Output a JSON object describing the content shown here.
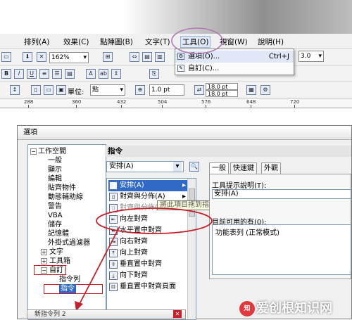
{
  "menubar": {
    "items": [
      {
        "label": "排列(A)"
      },
      {
        "label": "效果(C)"
      },
      {
        "label": "點陣圖(B)"
      },
      {
        "label": "文字(T)"
      },
      {
        "label": "工具(O)"
      },
      {
        "label": "視窗(W)"
      },
      {
        "label": "說明(H)"
      }
    ]
  },
  "toolbar1": {
    "zoom_value": "162%"
  },
  "tools_menu": {
    "items": [
      {
        "label": "選項(O)...",
        "shortcut": "Ctrl+J"
      },
      {
        "label": "自訂(C)..."
      }
    ],
    "right_value": "3.0"
  },
  "toolbar3": {
    "unit_label": "單位:",
    "unit_value": "點",
    "outline_value": "1.0 pt",
    "size1_value": "18.0 pt",
    "size2_value": "18.0 pt"
  },
  "ruler": {
    "labels": [
      "288",
      "360",
      "432",
      "504",
      "576",
      "648",
      "720"
    ]
  },
  "dialog": {
    "title": "選項",
    "tree": [
      {
        "label": "工作空間",
        "level": 0,
        "expander": "−"
      },
      {
        "label": "一般",
        "level": 1
      },
      {
        "label": "顯示",
        "level": 1
      },
      {
        "label": "編輯",
        "level": 1
      },
      {
        "label": "貼齊物件",
        "level": 1
      },
      {
        "label": "動態輔助線",
        "level": 1
      },
      {
        "label": "警告",
        "level": 1
      },
      {
        "label": "VBA",
        "level": 1
      },
      {
        "label": "儲存",
        "level": 1
      },
      {
        "label": "記憶體",
        "level": 1
      },
      {
        "label": "外掛式過濾器",
        "level": 1
      },
      {
        "label": "文字",
        "level": 1,
        "expander": "+"
      },
      {
        "label": "工具箱",
        "level": 1,
        "expander": "+"
      },
      {
        "label": "自訂",
        "level": 1,
        "expander": "−"
      },
      {
        "label": "指令列",
        "level": 2
      },
      {
        "label": "指令",
        "level": 2,
        "selected": true
      }
    ],
    "panel_title": "指令",
    "category_select": "安排(A)",
    "commands": [
      {
        "label": "安排(A)",
        "highlighted": true,
        "has_submenu": true
      },
      {
        "label": "對齊與分佈(A)",
        "has_submenu": true
      },
      {
        "label": "對齊與分佈(A)..."
      },
      {
        "label": "向左對齊"
      },
      {
        "label": "水平置中對齊"
      },
      {
        "label": "向右對齊"
      },
      {
        "label": "向上對齊"
      },
      {
        "label": "垂直置中對齊"
      },
      {
        "label": "向下對齊"
      },
      {
        "label": "垂直置中對齊頁面"
      }
    ],
    "drag_hint": "將此項目拖到指令列以新增",
    "tabs": [
      "一般",
      "快速鍵",
      "外觀"
    ],
    "tooltip_label": "工具提示說明(T):",
    "tooltip_value": "安排(A)",
    "currently_label": "目前可用的有(0):",
    "currently_value": "功能表列 (正常模式)"
  },
  "new_bar_title": "新指令列 2",
  "watermark": {
    "text": "爱创根知识网",
    "logo": "知"
  },
  "colors": {
    "annotation_red": "#c8202b",
    "accent_circle": "#b07ab5",
    "selection": "#3169c6"
  }
}
